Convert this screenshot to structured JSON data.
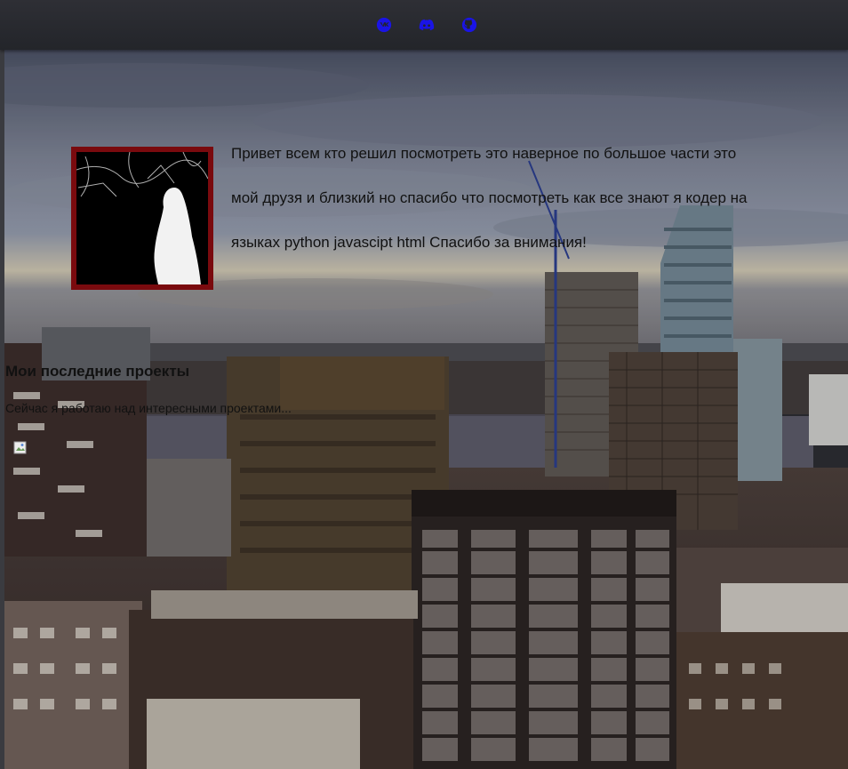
{
  "nav": {
    "icons": [
      "vk-icon",
      "discord-icon",
      "github-icon"
    ],
    "icon_color": "#1a14e6"
  },
  "intro": {
    "text": "Привет всем кто решил посмотреть это наверное по большое части это мой друзя и близкий но спасибо что посмотреть как все знают я кодер на языках python javascipt html Спасибо за внимания!",
    "avatar_border_color": "#7a0a0e"
  },
  "projects": {
    "title": "Мои последние проекты",
    "subtitle": "Сейчас я работаю над интересными проектами..."
  }
}
